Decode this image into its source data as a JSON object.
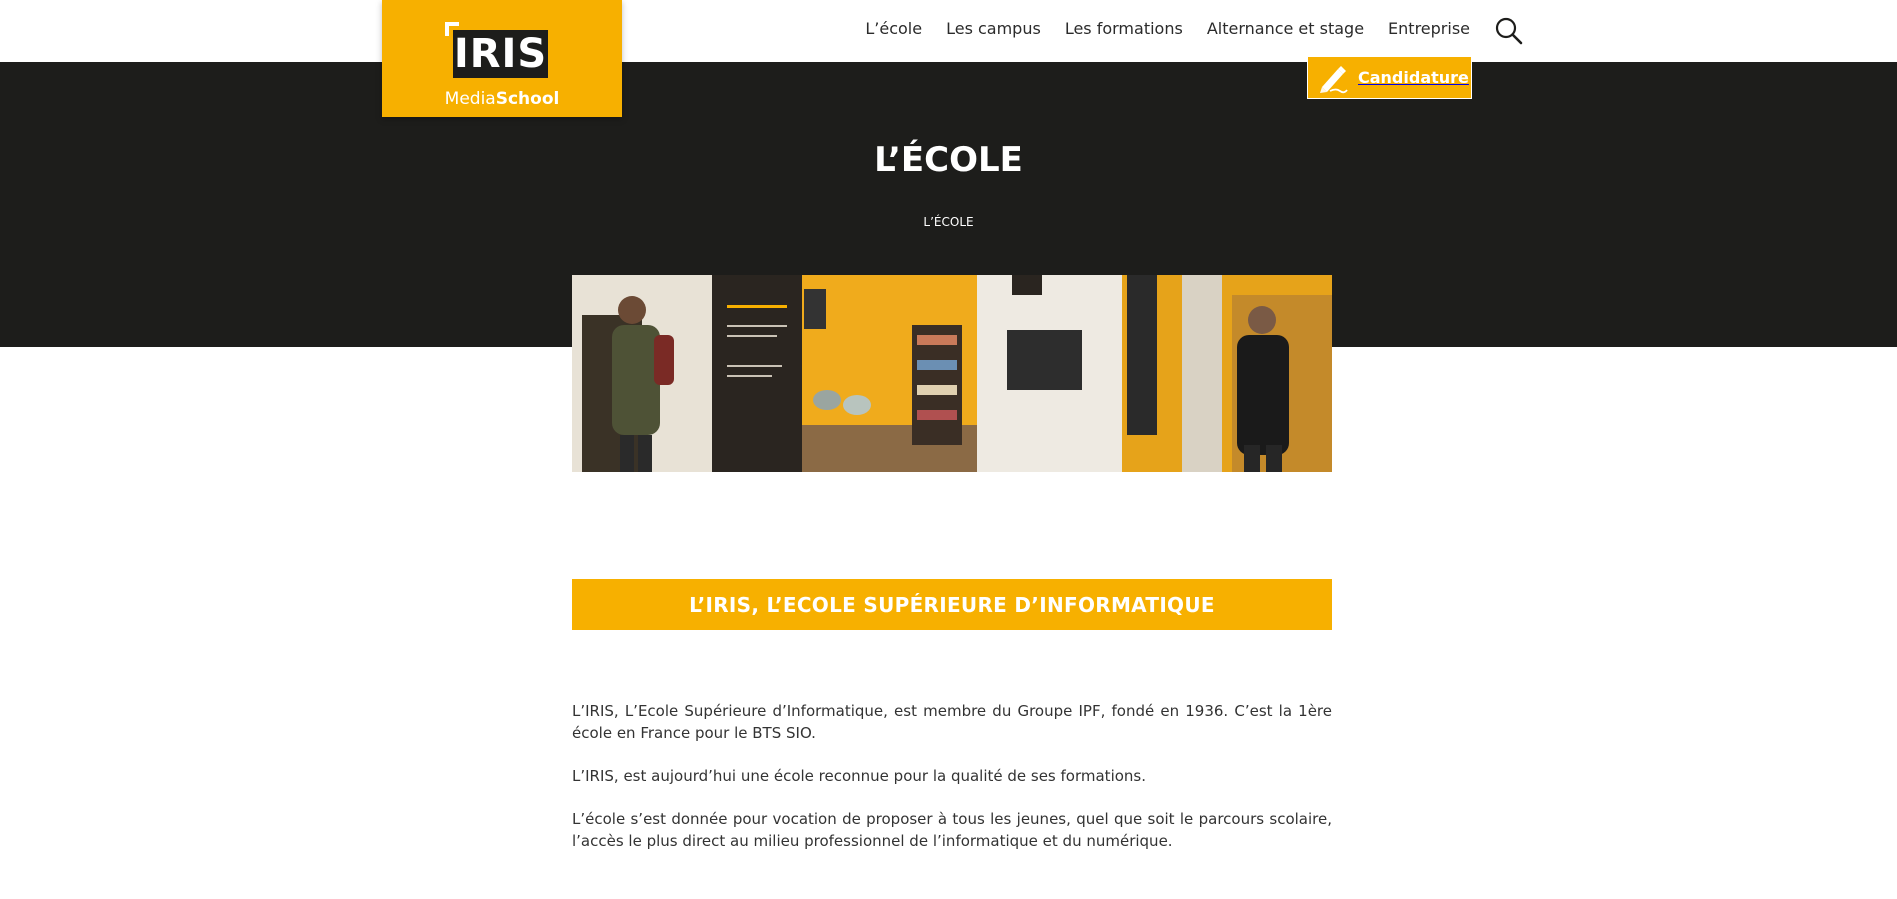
{
  "brand": {
    "logo_text": "IRIS",
    "sub_regular": "Media",
    "sub_bold": "School",
    "accent_color": "#f7b000",
    "dark_color": "#1d1d1b"
  },
  "nav": {
    "items": [
      {
        "label": "L’école"
      },
      {
        "label": "Les campus"
      },
      {
        "label": "Les formations"
      },
      {
        "label": "Alternance et stage"
      },
      {
        "label": "Entreprise"
      }
    ],
    "search_icon": "search-icon"
  },
  "candidature": {
    "label": "Candidature",
    "icon": "pen-icon"
  },
  "hero": {
    "title": "L’ÉCOLE",
    "breadcrumb": "L’ÉCOLE"
  },
  "section": {
    "heading": "L’IRIS, L’ECOLE SUPÉRIEURE D’INFORMATIQUE",
    "paragraphs": [
      "L’IRIS, L’Ecole Supérieure d’Informatique, est membre du Groupe IPF, fondé en 1936. C’est la 1ère école en France pour le BTS SIO.",
      "L’IRIS, est aujourd’hui une école reconnue pour la qualité de ses formations.",
      "L’école s’est donnée pour vocation de proposer à tous les jeunes, quel que soit le parcours scolaire, l’accès le plus direct au milieu professionnel de l’informatique et du numérique."
    ]
  }
}
